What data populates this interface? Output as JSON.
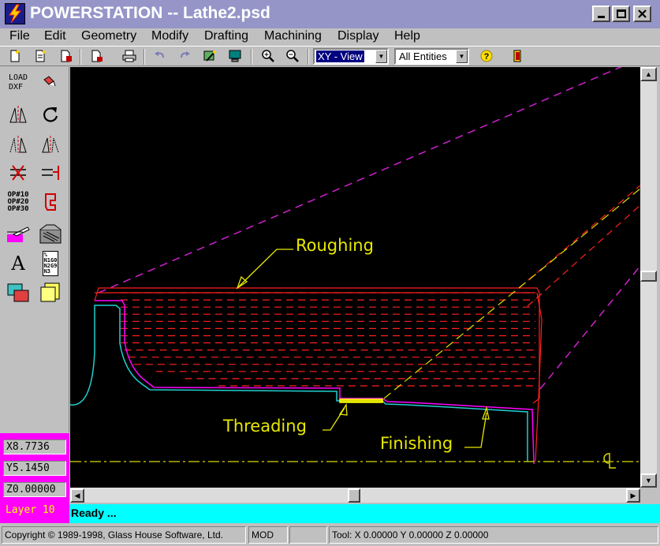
{
  "window": {
    "title": "POWERSTATION -- Lathe2.psd",
    "icon": "lightning-app-icon"
  },
  "menu": [
    "File",
    "Edit",
    "Geometry",
    "Modify",
    "Drafting",
    "Machining",
    "Display",
    "Help"
  ],
  "toolbar": {
    "view_combo": "XY - View",
    "entity_combo": "All Entities"
  },
  "palette": {
    "load_dxf": "LOAD\nDXF",
    "ops": "OP#10\nOP#20\nOP#30",
    "nc_code": "%\nN1G0\nN2G9\nN3",
    "text_tool": "A"
  },
  "readouts": {
    "x": "X8.7736",
    "y": "Y5.1450",
    "z": "Z0.00000",
    "layer": "Layer 10"
  },
  "drawing": {
    "labels": {
      "roughing": "Roughing",
      "threading": "Threading",
      "finishing": "Finishing"
    },
    "colors": {
      "roughing": "#ff2020",
      "finish": "#ff00ff",
      "profile": "#00e0e0",
      "threading": "#ffff00",
      "annotation": "#e8e800",
      "centerline": "#d8d800",
      "construction": "#d020d0"
    }
  },
  "status": {
    "message": "Ready ...",
    "copyright": "Copyright © 1989-1998, Glass House Software, Ltd.",
    "mode": "MOD",
    "tool": "Tool: X 0.00000 Y 0.00000 Z 0.00000"
  }
}
